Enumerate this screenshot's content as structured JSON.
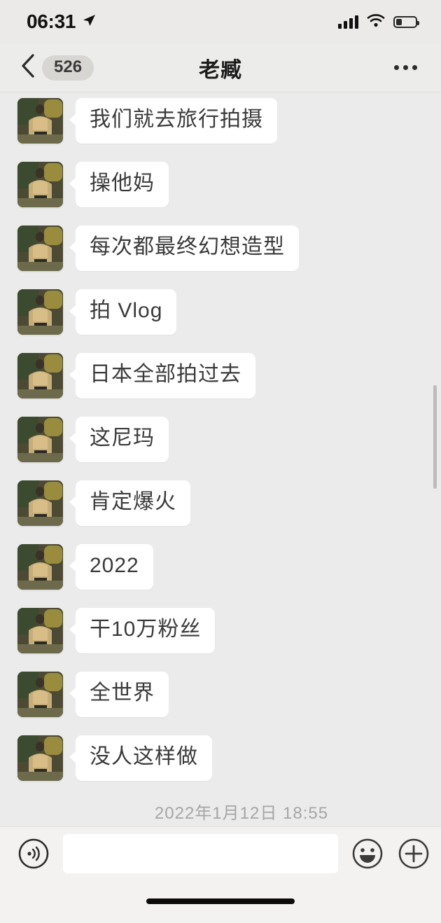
{
  "status_bar": {
    "time": "06:31",
    "location_icon": "location-arrow-icon",
    "signal_icon": "cellular-signal-icon",
    "wifi_icon": "wifi-icon",
    "battery_icon": "battery-icon",
    "battery_level_pct": 32
  },
  "nav_bar": {
    "back_icon": "back-chevron-icon",
    "unread_count": "526",
    "title": "老臧",
    "more_icon": "more-options-icon"
  },
  "chat": {
    "avatar_alt": "bodybuilder-avatar",
    "messages": [
      {
        "text": "我们就去旅行拍摄"
      },
      {
        "text": "操他妈"
      },
      {
        "text": "每次都最终幻想造型"
      },
      {
        "text": "拍 Vlog"
      },
      {
        "text": "日本全部拍过去"
      },
      {
        "text": "这尼玛"
      },
      {
        "text": "肯定爆火"
      },
      {
        "text": "2022"
      },
      {
        "text": "干10万粉丝"
      },
      {
        "text": "全世界"
      },
      {
        "text": "没人这样做"
      }
    ],
    "timestamp": "2022年1月12日 18:55"
  },
  "input_bar": {
    "voice_icon": "voice-message-icon",
    "input_value": "",
    "input_placeholder": "",
    "emoji_icon": "emoji-smiley-icon",
    "plus_icon": "plus-more-icon"
  },
  "colors": {
    "chat_background": "#ebebeb",
    "bubble_background": "#ffffff",
    "nav_background": "#ececea",
    "input_background": "#f3f2f0",
    "text_primary": "#3a3a3a",
    "timestamp_text": "#a6a6a6",
    "badge_background": "#d8d6d3"
  }
}
